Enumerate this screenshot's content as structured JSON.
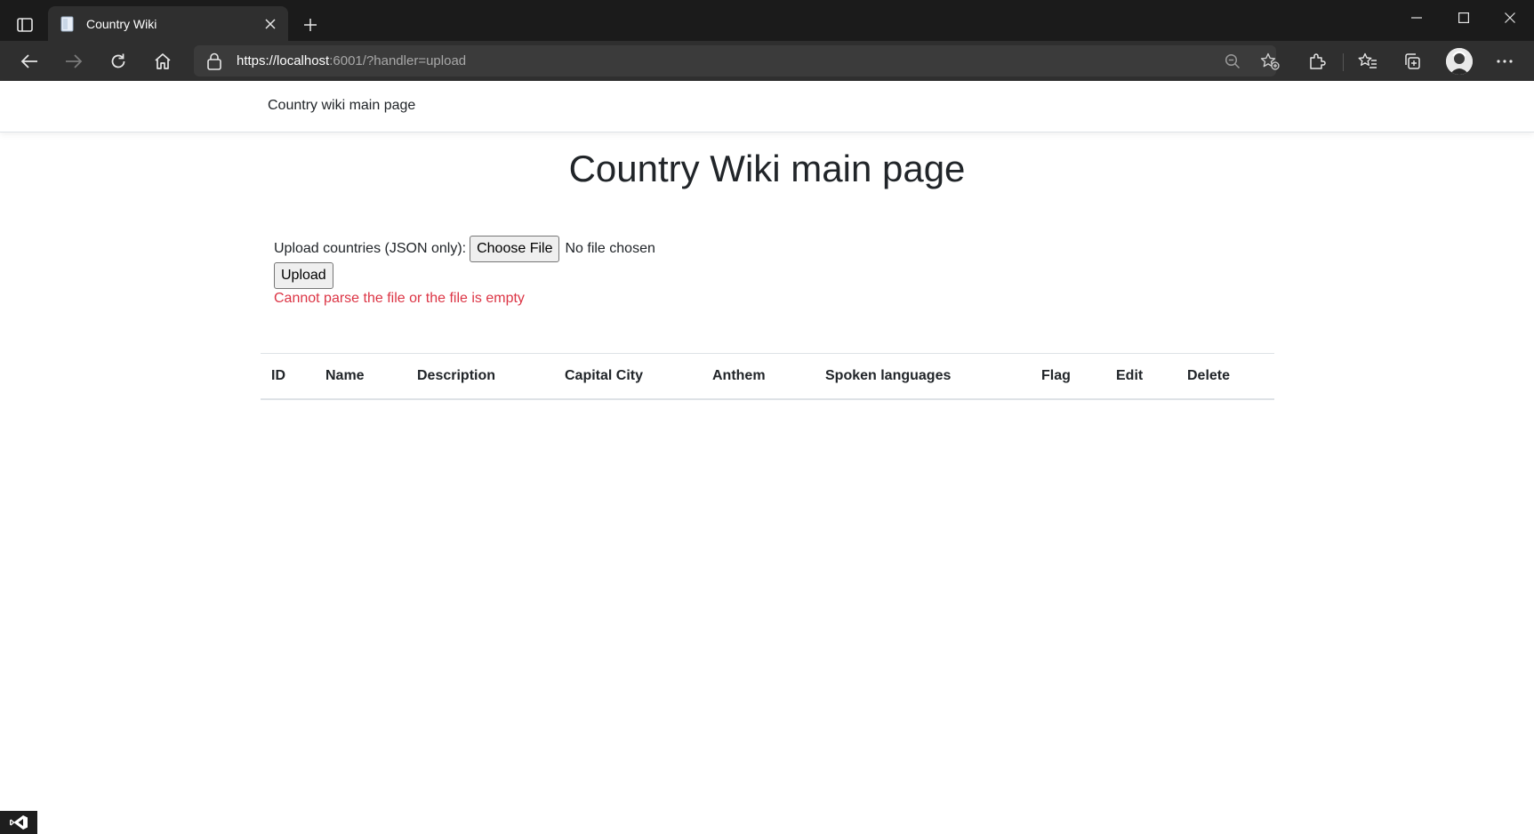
{
  "browser": {
    "tab_title": "Country Wiki",
    "url": {
      "host_part": "https://localhost",
      "rest_part": ":6001/?handler=upload"
    }
  },
  "site": {
    "nav_brand": "Country wiki main page",
    "page_title": "Country Wiki main page"
  },
  "upload_form": {
    "label": "Upload countries (JSON only):",
    "choose_file_label": "Choose File",
    "no_file_text": "No file chosen",
    "upload_button": "Upload",
    "error_message": "Cannot parse the file or the file is empty"
  },
  "table": {
    "columns": [
      "ID",
      "Name",
      "Description",
      "Capital City",
      "Anthem",
      "Spoken languages",
      "Flag",
      "Edit",
      "Delete"
    ],
    "rows": []
  },
  "colors": {
    "error": "#dc3545",
    "titlebar": "#1b1b1b",
    "toolbar": "#2f2f2f"
  }
}
